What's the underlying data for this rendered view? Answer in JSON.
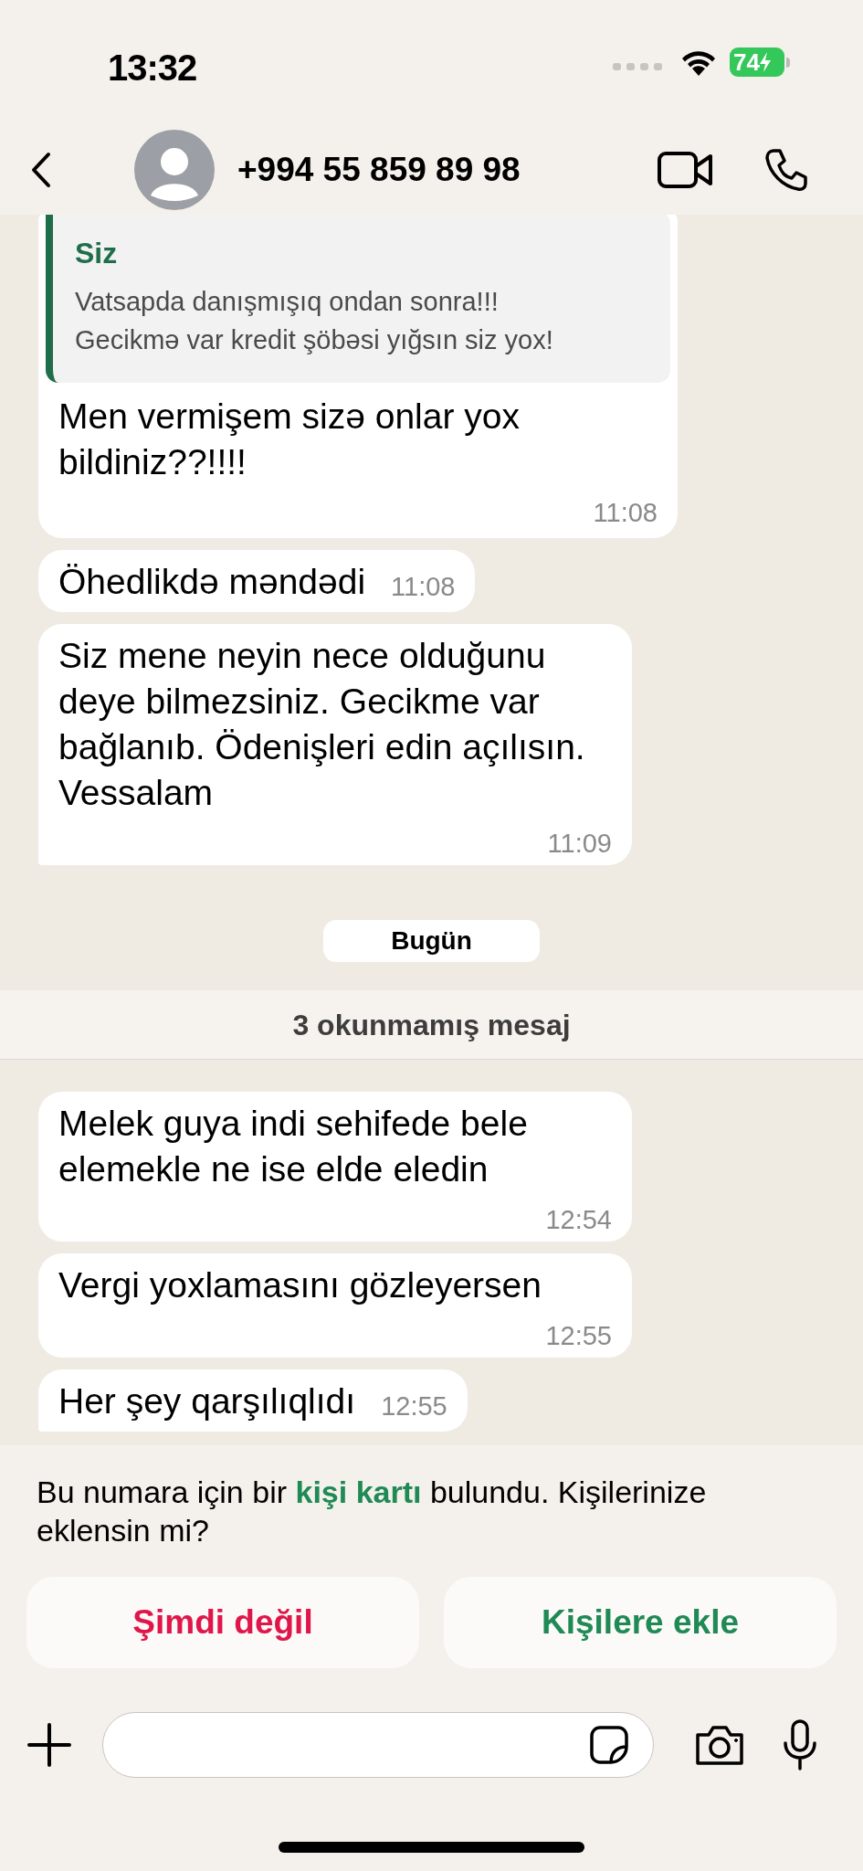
{
  "status_bar": {
    "time": "13:32",
    "battery": "74"
  },
  "header": {
    "contact": "+994 55 859 89 98"
  },
  "chat": [
    {
      "kind": "message",
      "quote": {
        "author": "Siz",
        "lines": [
          "Vatsapda danışmışıq ondan sonra!!!",
          "Gecikmə var kredit şöbəsi yığsın siz yox!"
        ]
      },
      "text": "Men vermişem sizə onlar yox bildiniz??!!!!",
      "time": "11:08",
      "tail": false
    },
    {
      "kind": "message",
      "text": "Öhedlikdə məndədi",
      "time": "11:08",
      "tail": false
    },
    {
      "kind": "message",
      "text": "Siz mene neyin nece olduğunu deye bilmezsiniz. Gecikme var bağlanıb. Ödenişleri edin açılısın. Vessalam",
      "time": "11:09",
      "tail": true
    },
    {
      "kind": "date",
      "text": "Bugün"
    },
    {
      "kind": "unread",
      "text": "3 okunmamış mesaj"
    },
    {
      "kind": "message",
      "text": "Melek guya indi sehifede bele elemekle ne ise elde eledin",
      "time": "12:54",
      "tail": false
    },
    {
      "kind": "message",
      "text": "Vergi yoxlamasını gözleyersen",
      "time": "12:55",
      "tail": false
    },
    {
      "kind": "message",
      "text": "Her şey qarşılıqlıdı",
      "time": "12:55",
      "tail": true
    }
  ],
  "contact_prompt": {
    "before": "Bu numara için bir",
    "link": "kişi kartı",
    "after": "bulundu. Kişilerinize eklensin mi?"
  },
  "prompt_buttons": [
    {
      "label": "Şimdi değil",
      "kind": "dismiss"
    },
    {
      "label": "Kişilere ekle",
      "kind": "add"
    }
  ]
}
